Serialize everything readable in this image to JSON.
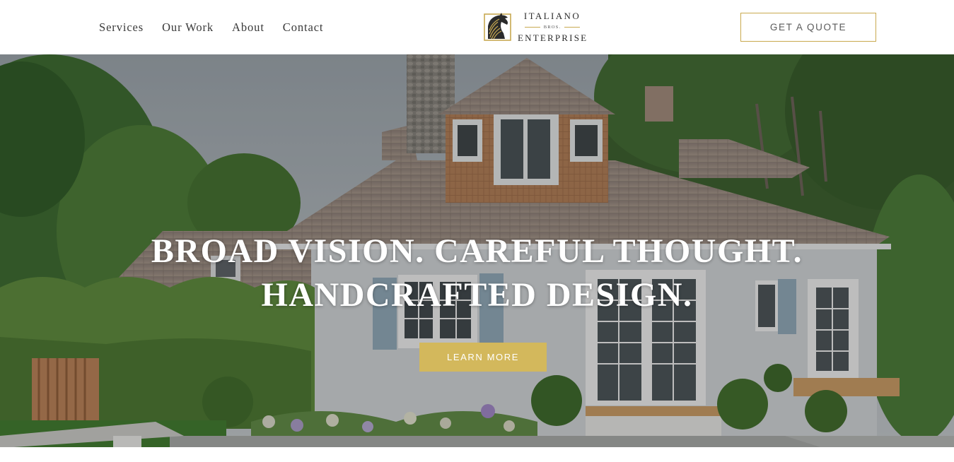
{
  "nav": {
    "items": [
      {
        "label": "Services"
      },
      {
        "label": "Our Work"
      },
      {
        "label": "About"
      },
      {
        "label": "Contact"
      }
    ]
  },
  "logo": {
    "line1": "ITALIANO",
    "line2": "BROS.",
    "line3": "ENTERPRISE",
    "icon": "stylized-horse-head-icon",
    "accent_color": "#c8a951"
  },
  "header": {
    "quote_button": "GET A QUOTE"
  },
  "hero": {
    "title_line1": "BROAD VISION. CAREFUL THOUGHT.",
    "title_line2": "HANDCRAFTED DESIGN.",
    "button": "LEARN MORE",
    "button_color": "#d3b85c",
    "image": "cedar-shingle-cottage-photo"
  }
}
